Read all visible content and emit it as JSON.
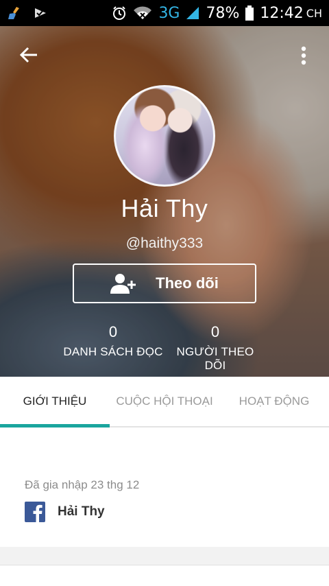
{
  "status_bar": {
    "battery": "78%",
    "time": "12:42",
    "ampm": "CH",
    "network": "3G",
    "icons": [
      "broom-icon",
      "check-icon",
      "alarm-icon",
      "wifi-icon",
      "signal-icon",
      "battery-icon"
    ]
  },
  "profile": {
    "display_name": "Hải Thy",
    "username": "@haithy333",
    "follow_label": "Theo dõi"
  },
  "stats": [
    {
      "value": "0",
      "label": "DANH SÁCH ĐỌC"
    },
    {
      "value": "0",
      "label": "NGƯỜI THEO DÕI"
    }
  ],
  "tabs": [
    {
      "label": "GIỚI THIỆU",
      "active": true
    },
    {
      "label": "CUỘC HỘI THOẠI",
      "active": false
    },
    {
      "label": "HOẠT ĐỘNG",
      "active": false
    }
  ],
  "about": {
    "joined": "Đã gia nhập 23 thg 12",
    "facebook_name": "Hải Thy"
  },
  "colors": {
    "accent": "#1aa59e",
    "facebook": "#3b5998",
    "network": "#33b5e5"
  }
}
